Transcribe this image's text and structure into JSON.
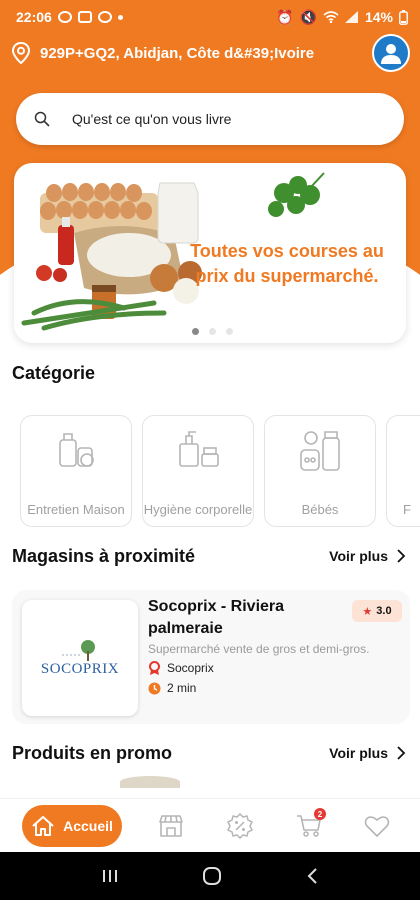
{
  "status_bar": {
    "time": "22:06",
    "battery": "14%"
  },
  "location": {
    "address": "929P+GQ2, Abidjan, Côte d&#39;Ivoire"
  },
  "search": {
    "placeholder": "Qu'est ce qu'on vous livre"
  },
  "banner": {
    "text": "Toutes vos courses au prix du supermarché.",
    "slide_count": 3,
    "active_slide": 1
  },
  "categories": {
    "title": "Catégorie",
    "items": [
      {
        "label": "Entretien Maison",
        "icon": "cleaning-products-icon"
      },
      {
        "label": "Hygiène corporelle",
        "icon": "hygiene-products-icon"
      },
      {
        "label": "Bébés",
        "icon": "baby-products-icon"
      },
      {
        "label": "F",
        "icon": "category-icon"
      }
    ]
  },
  "nearby_stores": {
    "title": "Magasins à proximité",
    "see_more": "Voir plus",
    "stores": [
      {
        "name": "Socoprix - Riviera palmeraie",
        "rating": "3.0",
        "description": "Supermarché vente de gros et demi-gros.",
        "brand": "Socoprix",
        "delivery_time": "2 min",
        "logo_text": "SOCOPRIX"
      }
    ]
  },
  "promo": {
    "title": "Produits en promo",
    "see_more": "Voir plus"
  },
  "bottom_nav": {
    "home_label": "Accueil",
    "cart_count": "2",
    "items": [
      "home-icon",
      "store-icon",
      "discount-icon",
      "cart-icon",
      "heart-icon"
    ]
  },
  "colors": {
    "primary": "#F07A22",
    "avatar": "#1F7AC8",
    "rating_bg": "#fde2d6"
  }
}
